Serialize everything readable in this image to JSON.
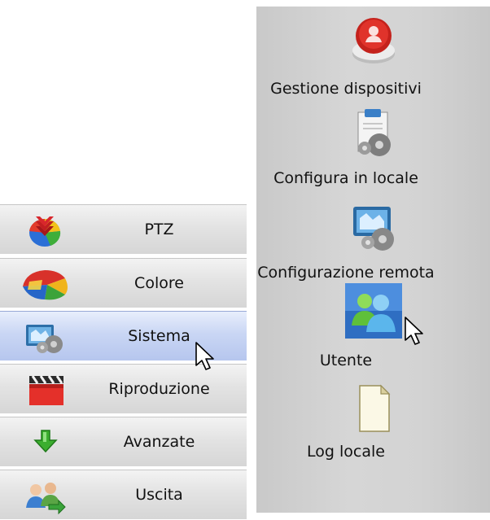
{
  "left_menu": {
    "items": [
      {
        "label": "PTZ",
        "icon": "ptz-icon",
        "active": false
      },
      {
        "label": "Colore",
        "icon": "color-icon",
        "active": false
      },
      {
        "label": "Sistema",
        "icon": "system-icon",
        "active": true
      },
      {
        "label": "Riproduzione",
        "icon": "playback-icon",
        "active": false
      },
      {
        "label": "Avanzate",
        "icon": "advanced-icon",
        "active": false
      },
      {
        "label": "Uscita",
        "icon": "exit-icon",
        "active": false
      }
    ]
  },
  "right_panel": {
    "items": [
      {
        "label": "Gestione dispositivi",
        "icon": "device-manager-icon"
      },
      {
        "label": "Configura in locale",
        "icon": "local-config-icon"
      },
      {
        "label": "Configurazione remota",
        "icon": "remote-config-icon"
      },
      {
        "label": "Utente",
        "icon": "user-icon"
      },
      {
        "label": "Log locale",
        "icon": "local-log-icon"
      }
    ]
  },
  "colors": {
    "menu_active": "#c9d6f4",
    "menu_normal": "#e3e3e3",
    "panel_bg": "#d3d3d3"
  }
}
